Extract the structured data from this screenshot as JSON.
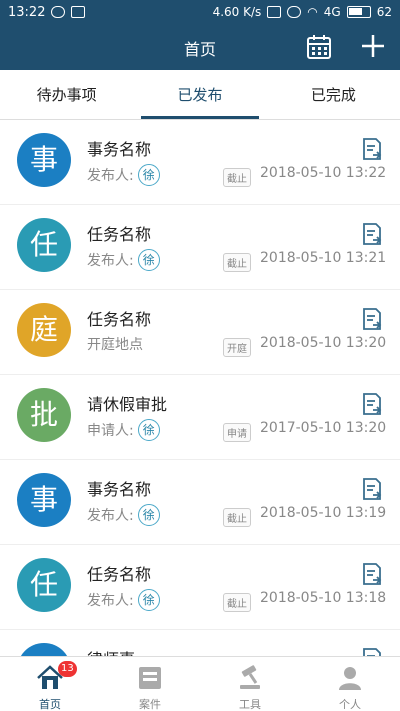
{
  "status_bar": {
    "time": "13:22",
    "speed": "4.60 K/s",
    "network": "4G",
    "battery": "62"
  },
  "nav": {
    "title": "首页"
  },
  "tabs": [
    {
      "label": "待办事项"
    },
    {
      "label": "已发布"
    },
    {
      "label": "已完成"
    }
  ],
  "active_tab": "已发布",
  "items": [
    {
      "avatar": "事",
      "color": "#1b7fc3",
      "title": "事务名称",
      "sub_label": "发布人:",
      "person": "徐",
      "tag": "截止",
      "time": "2018-05-10 13:22"
    },
    {
      "avatar": "任",
      "color": "#2a9bb4",
      "title": "任务名称",
      "sub_label": "发布人:",
      "person": "徐",
      "tag": "截止",
      "time": "2018-05-10 13:21"
    },
    {
      "avatar": "庭",
      "color": "#e0a528",
      "title": "任务名称",
      "sub_label": "开庭地点",
      "person": "",
      "tag": "开庭",
      "time": "2018-05-10 13:20"
    },
    {
      "avatar": "批",
      "color": "#6aaa64",
      "title": "请休假审批",
      "sub_label": "申请人:",
      "person": "徐",
      "tag": "申请",
      "time": "2017-05-10 13:20"
    },
    {
      "avatar": "事",
      "color": "#1b7fc3",
      "title": "事务名称",
      "sub_label": "发布人:",
      "person": "徐",
      "tag": "截止",
      "time": "2018-05-10 13:19"
    },
    {
      "avatar": "任",
      "color": "#2a9bb4",
      "title": "任务名称",
      "sub_label": "发布人:",
      "person": "徐",
      "tag": "截止",
      "time": "2018-05-10 13:18"
    },
    {
      "avatar": "",
      "color": "#1b7fc3",
      "title": "律师事",
      "sub_label": "",
      "person": "",
      "tag": "",
      "time": ""
    }
  ],
  "tabbar": [
    {
      "label": "首页",
      "icon": "home-icon",
      "badge": "13"
    },
    {
      "label": "案件",
      "icon": "case-icon",
      "badge": ""
    },
    {
      "label": "工具",
      "icon": "gavel-icon",
      "badge": ""
    },
    {
      "label": "个人",
      "icon": "person-icon",
      "badge": ""
    }
  ],
  "colors": {
    "primary": "#1f4e6e",
    "badge": "#e33333"
  }
}
